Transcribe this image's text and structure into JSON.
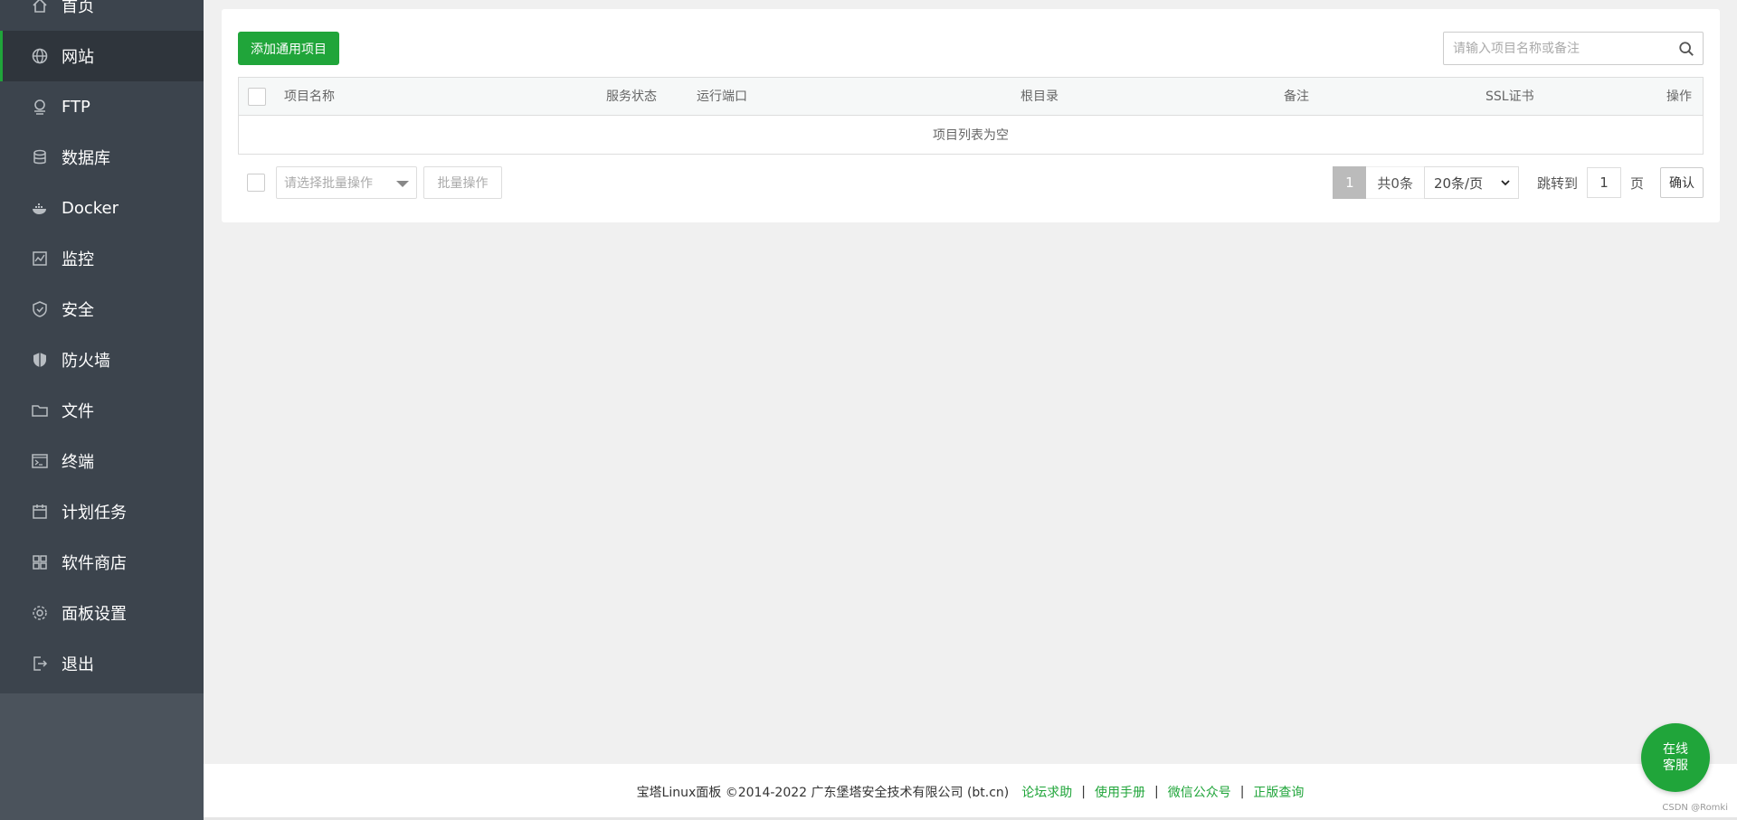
{
  "sidebar": {
    "items": [
      {
        "label": "首页",
        "icon": "home-icon"
      },
      {
        "label": "网站",
        "icon": "globe-icon",
        "active": true
      },
      {
        "label": "FTP",
        "icon": "ftp-icon"
      },
      {
        "label": "数据库",
        "icon": "database-icon"
      },
      {
        "label": "Docker",
        "icon": "docker-icon"
      },
      {
        "label": "监控",
        "icon": "monitor-icon"
      },
      {
        "label": "安全",
        "icon": "shield-icon"
      },
      {
        "label": "防火墙",
        "icon": "firewall-icon"
      },
      {
        "label": "文件",
        "icon": "folder-icon"
      },
      {
        "label": "终端",
        "icon": "terminal-icon"
      },
      {
        "label": "计划任务",
        "icon": "calendar-icon"
      },
      {
        "label": "软件商店",
        "icon": "grid-icon"
      },
      {
        "label": "面板设置",
        "icon": "gear-icon"
      },
      {
        "label": "退出",
        "icon": "logout-icon"
      }
    ]
  },
  "toolbar": {
    "add_label": "添加通用项目",
    "search_placeholder": "请输入项目名称或备注"
  },
  "table": {
    "columns": [
      "项目名称",
      "服务状态",
      "运行端口",
      "根目录",
      "备注",
      "SSL证书",
      "操作"
    ],
    "empty_text": "项目列表为空"
  },
  "batch": {
    "select_placeholder": "请选择批量操作",
    "button_label": "批量操作"
  },
  "pager": {
    "current_page": "1",
    "total": "共0条",
    "page_size": "20条/页",
    "jump_label": "跳转到",
    "jump_value": "1",
    "unit": "页",
    "confirm": "确认"
  },
  "footer": {
    "copyright": "宝塔Linux面板 ©2014-2022 广东堡塔安全技术有限公司 (bt.cn)",
    "links": [
      "论坛求助",
      "使用手册",
      "微信公众号",
      "正版查询"
    ],
    "separator": "|"
  },
  "chat": {
    "line1": "在线",
    "line2": "客服"
  },
  "watermark": "CSDN @Romki",
  "colors": {
    "accent": "#20a53a",
    "sidebar": "#3c444d"
  }
}
